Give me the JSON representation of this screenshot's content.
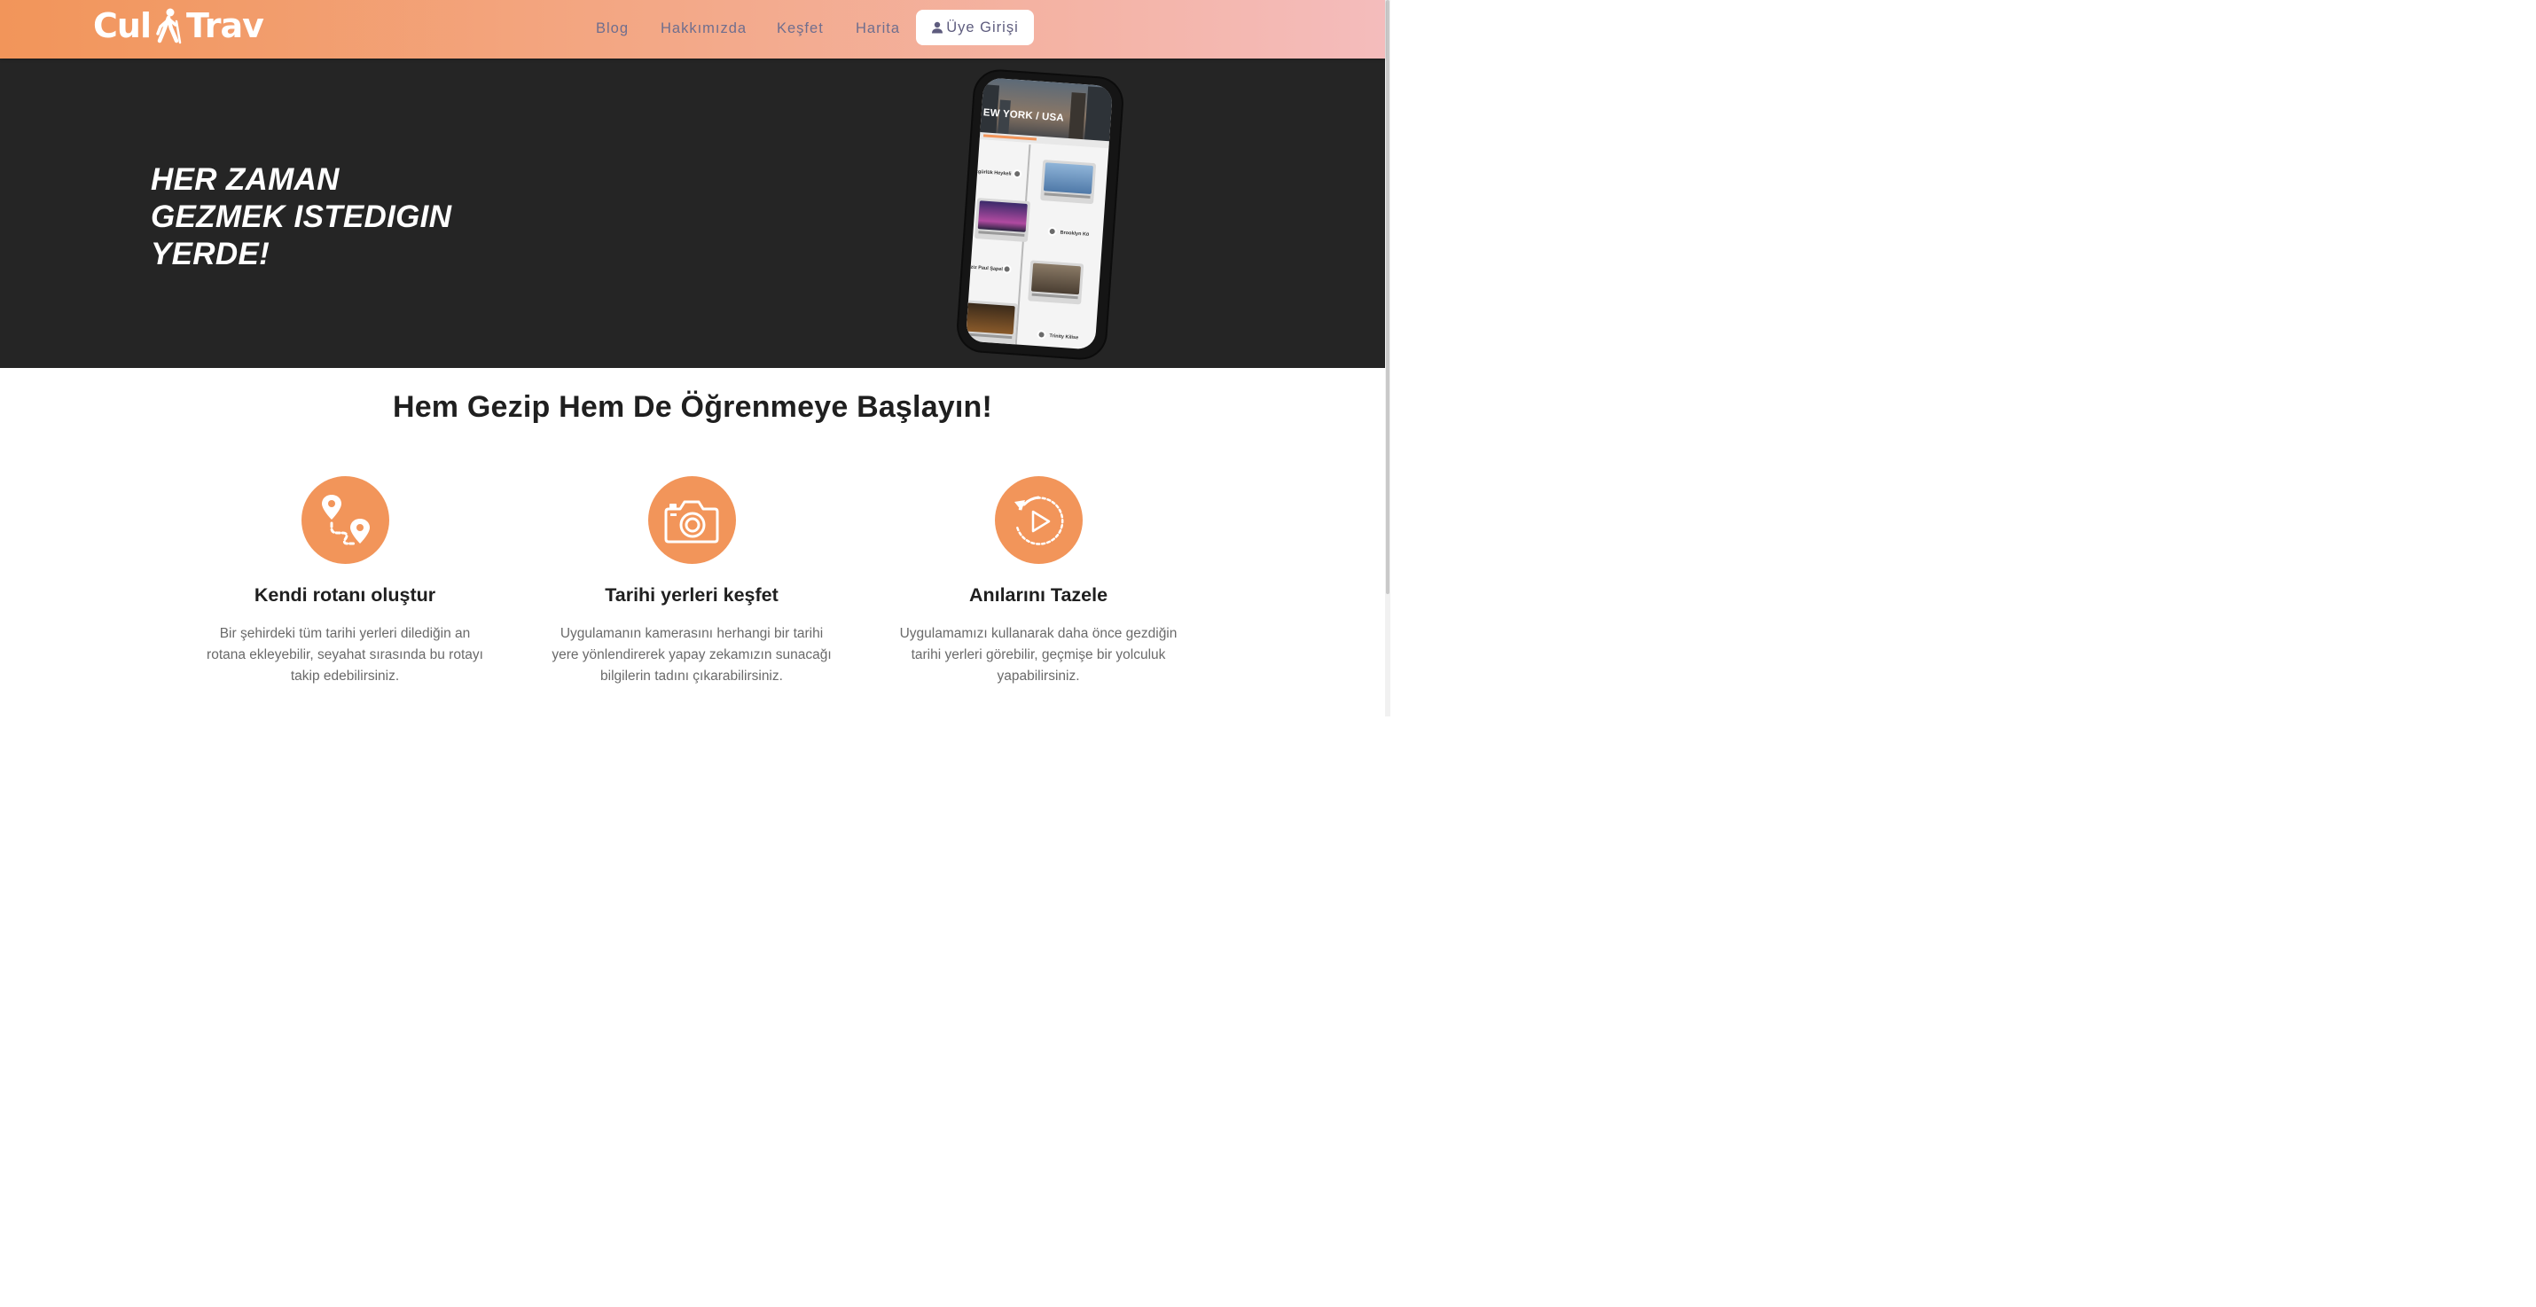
{
  "header": {
    "logo": {
      "part1": "Cul",
      "part2": "Trav",
      "icon": "hiker-icon"
    },
    "nav": {
      "blog": "Blog",
      "about": "Hakkımızda",
      "discover": "Keşfet",
      "map": "Harita",
      "login": "Üye Girişi",
      "login_icon": "user-icon"
    }
  },
  "hero": {
    "title_lines": [
      "HER ZAMAN",
      "GEZMEK ISTEDIGIN",
      "YERDE!"
    ],
    "phone": {
      "city_title": "EW YORK / USA",
      "stops": [
        "zgürlük Heykeli",
        "Brooklyn Kö",
        "Aziz Paul Şapeli",
        "Trinity Kilise"
      ]
    }
  },
  "features_section": {
    "title": "Hem Gezip Hem De Öğrenmeye Başlayın!",
    "items": [
      {
        "icon": "route-pins-icon",
        "title": "Kendi rotanı oluştur",
        "text": "Bir şehirdeki tüm tarihi yerleri dilediğin an rotana ekleyebilir, seyahat sırasında bu rotayı takip edebilirsiniz."
      },
      {
        "icon": "camera-icon",
        "title": "Tarihi yerleri keşfet",
        "text": "Uygulamanın kamerasını herhangi bir tarihi yere yönlendirerek yapay zekamızın sunacağı bilgilerin tadını çıkarabilirsiniz."
      },
      {
        "icon": "replay-icon",
        "title": "Anılarını Tazele",
        "text": "Uygulamamızı kullanarak daha önce gezdiğin tarihi yerleri görebilir, geçmişe bir yolculuk yapabilirsiniz."
      }
    ]
  },
  "colors": {
    "accent": "#f2955a",
    "header_gradient_end": "#f4bcbc",
    "hero_bg": "#252525",
    "nav_text": "#6f6e8e"
  }
}
